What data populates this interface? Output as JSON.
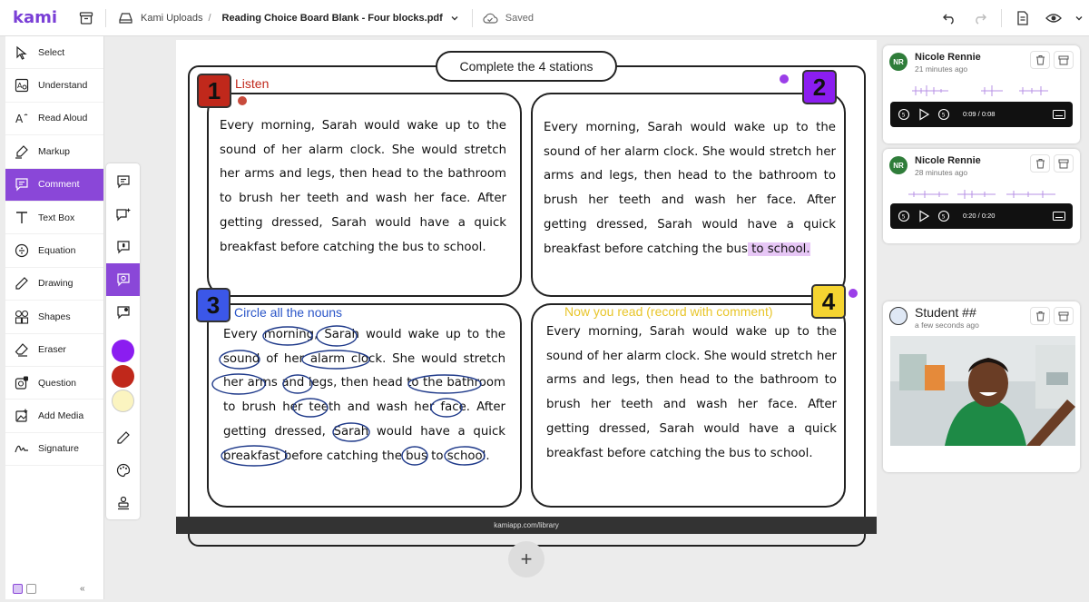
{
  "app": {
    "logo": "kami"
  },
  "header": {
    "folder": "Kami Uploads",
    "separator": "/",
    "filename": "Reading Choice Board Blank - Four blocks.pdf",
    "save_status": "Saved"
  },
  "sidebar": {
    "tools": [
      {
        "label": "Select",
        "icon": "cursor-icon"
      },
      {
        "label": "Understand",
        "icon": "dictionary-icon"
      },
      {
        "label": "Read Aloud",
        "icon": "read-aloud-icon"
      },
      {
        "label": "Markup",
        "icon": "highlighter-icon"
      },
      {
        "label": "Comment",
        "icon": "comment-icon",
        "active": true
      },
      {
        "label": "Text Box",
        "icon": "text-icon"
      },
      {
        "label": "Equation",
        "icon": "equation-icon"
      },
      {
        "label": "Drawing",
        "icon": "pencil-icon"
      },
      {
        "label": "Shapes",
        "icon": "shapes-icon"
      },
      {
        "label": "Eraser",
        "icon": "eraser-icon"
      },
      {
        "label": "Question",
        "icon": "question-icon"
      },
      {
        "label": "Add Media",
        "icon": "media-icon"
      },
      {
        "label": "Signature",
        "icon": "signature-icon"
      }
    ]
  },
  "comment_subtools": {
    "icons": [
      "text-comment-icon",
      "ai-comment-icon",
      "audio-comment-icon",
      "video-comment-icon",
      "screen-comment-icon"
    ],
    "active_index": 3,
    "colors": [
      "#8b1df0",
      "#c0281b",
      "#fbf4c0"
    ]
  },
  "document": {
    "banner": "Complete the 4 stations",
    "paragraph_plain": "Every morning, Sarah would wake up to the sound of her alarm clock. She would stretch her arms and legs, then head to the bathroom to brush her teeth and wash her face. After getting dressed, Sarah would have a quick breakfast before catching the bus to school.",
    "paragraph_lead": "Every morning, Sarah would wake up to the sound of her alarm clock. She would stretch her arms and legs, then head to the bathroom to brush her teeth and wash her face. After getting dressed, Sarah would have a quick breakfast before catching the bus",
    "paragraph_highlight": " to school.",
    "stations": [
      {
        "number": "1",
        "label": "Listen",
        "number_color": "#c0281b",
        "label_color": "#c0281b"
      },
      {
        "number": "2",
        "label": "",
        "number_color": "#8b1df0"
      },
      {
        "number": "3",
        "label": "Circle all the nouns",
        "number_color": "#3b57e8",
        "label_color": "#2a55c8"
      },
      {
        "number": "4",
        "label": "Now you read (record with comment)",
        "number_color": "#f5d431",
        "label_color": "#e8c52a"
      }
    ],
    "footer": "kamiapp.com/library",
    "highlight_color": "#e7c7f6",
    "ink_color": "#1f3a8a"
  },
  "comments": [
    {
      "initials": "NR",
      "name": "Nicole Rennie",
      "time": "21 minutes ago",
      "audio_time": "0:09 / 0:08"
    },
    {
      "initials": "NR",
      "name": "Nicole Rennie",
      "time": "28 minutes ago",
      "audio_time": "0:20 / 0:20"
    },
    {
      "initials": "",
      "name": "Student ##",
      "time": "a few seconds ago",
      "media": "video thumbnail of a smiling boy in a green shirt"
    }
  ],
  "add_page": "+"
}
